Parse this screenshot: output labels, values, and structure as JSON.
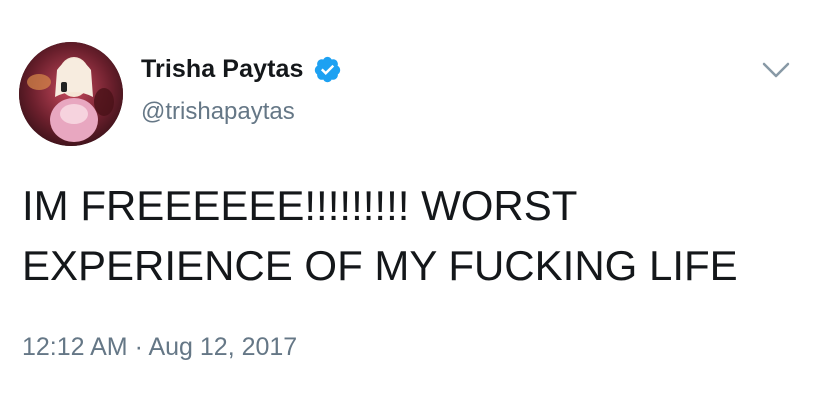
{
  "tweet": {
    "author": {
      "display_name": "Trisha Paytas",
      "handle": "@trishapaytas",
      "verified": true,
      "avatar_icon": "profile-photo"
    },
    "menu_icon": "chevron-down-icon",
    "text": "IM FREEEEEE!!!!!!!!! WORST\nEXPERIENCE OF MY FUCKING LIFE",
    "timestamp": "12:12 AM · Aug 12, 2017"
  },
  "colors": {
    "verified_badge": "#1da1f2",
    "text_primary": "#14171a",
    "text_secondary": "#657786"
  }
}
